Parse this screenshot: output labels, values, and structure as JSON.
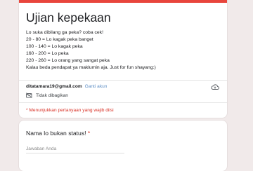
{
  "form": {
    "title": "Ujian kepekaan",
    "description_lines": [
      "Lo suka dibilang ga peka? coba cek!",
      "20 - 80 = Lo kagak peka banget",
      "100 - 140 = Lo kagak peka",
      "160 - 200 = Lo peka",
      "220 - 260 = Lo orang yang sangat peka",
      "",
      "Kalau beda pendapat ya maklumin aja. Just for fun shayang:)"
    ],
    "account_email": "ditatamara19@gmail.com",
    "switch_account": "Ganti akun",
    "not_shared": "Tidak dibagikan",
    "required_note": "* Menunjukkan pertanyaan yang wajib diisi"
  },
  "question": {
    "label": "Nama lo bukan status!",
    "required_marker": "*",
    "placeholder": "Jawaban Anda"
  },
  "colors": {
    "accent": "#e8453c",
    "required": "#d93025",
    "link": "#5f8fc5",
    "background": "#f1eaea"
  },
  "icons": {
    "cloud": "cloud-sync-icon",
    "notshared": "not-shared-icon"
  }
}
